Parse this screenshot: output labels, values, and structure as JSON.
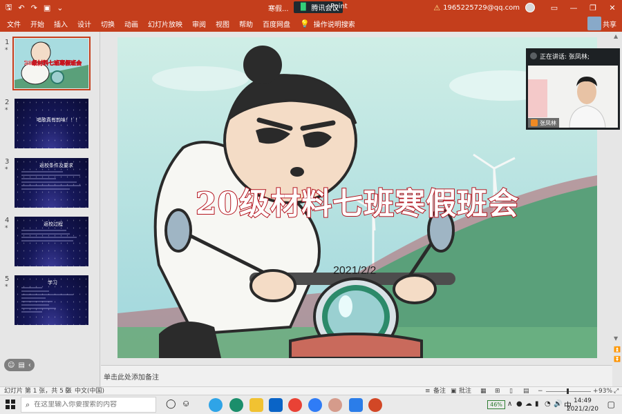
{
  "titlebar": {
    "doc_title": "寒假...",
    "doc_title_suffix": "Point",
    "meeting_app": "腾讯会议",
    "account": "1965225729@qq.com",
    "window_buttons": [
      "—",
      "❐",
      "✕"
    ]
  },
  "ribbon": {
    "tabs": [
      "文件",
      "开始",
      "插入",
      "设计",
      "切换",
      "动画",
      "幻灯片放映",
      "审阅",
      "视图",
      "帮助",
      "百度网盘"
    ],
    "tell_me": "操作说明搜索",
    "share": "共享"
  },
  "thumbnails": [
    {
      "num": "1",
      "star": "*",
      "title": "20级材料七班寒假班会"
    },
    {
      "num": "2",
      "star": "*",
      "title": "唱歌真有韵味！！！"
    },
    {
      "num": "3",
      "star": "*",
      "title": "返校条件及要求"
    },
    {
      "num": "4",
      "star": "*",
      "title": "返校过程"
    },
    {
      "num": "5",
      "star": "*",
      "title": "学习"
    }
  ],
  "slide": {
    "title": "20级材料七班寒假班会",
    "date": "2021/2/2"
  },
  "notes_placeholder": "单击此处添加备注",
  "video": {
    "speaking_label": "正在讲话: 张凤林;",
    "name": "张凤林"
  },
  "status": {
    "slide_info": "幻灯片 第 1 张，共 5 张",
    "language": "中文(中国)",
    "notes_btn": "备注",
    "comments_btn": "批注",
    "zoom": "93%"
  },
  "taskbar": {
    "search_placeholder": "在这里输入你要搜索的内容",
    "battery": "46%",
    "ime": "中",
    "time": "14:49",
    "date": "2021/2/20"
  },
  "colors": {
    "ribbon": "#c43e1c",
    "title_stroke": "#b3121c",
    "sky": "#a8dce0",
    "hill": "#5aa07a"
  }
}
